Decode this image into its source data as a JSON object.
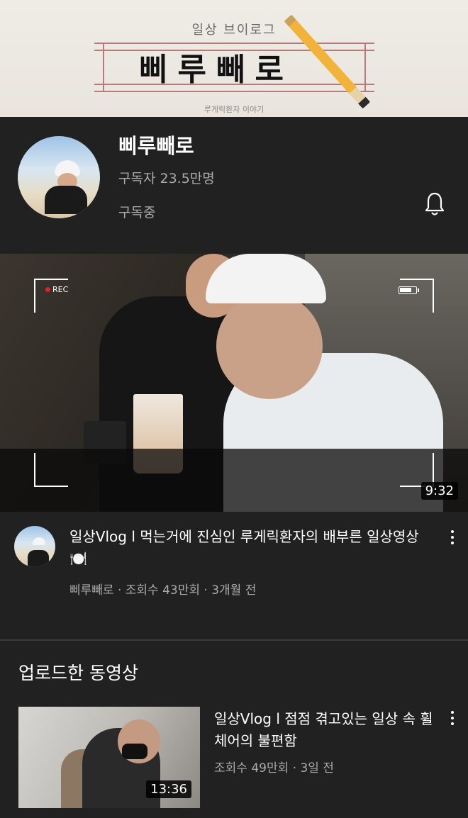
{
  "banner": {
    "subtitle": "일상 브이로그",
    "title": "삐루빼로",
    "caption": "루게릭환자 이야기"
  },
  "channel": {
    "name": "삐루빼로",
    "subscribers": "구독자 23.5만명",
    "subscribed_label": "구독중",
    "notification_icon": "bell-icon"
  },
  "featured": {
    "rec_label": "REC",
    "duration": "9:32",
    "title": "일상Vlog l 먹는거에 진심인 루게릭환자의 배부른 일상영상🍽️",
    "meta": "삐루빼로 · 조회수 43만회 · 3개월 전"
  },
  "uploads": {
    "section_title": "업로드한 동영상",
    "items": [
      {
        "title": "일상Vlog l 점점 겪고있는 일상 속 휠체어의 불편함",
        "meta": "조회수 49만회 · 3일 전",
        "duration": "13:36"
      }
    ]
  },
  "colors": {
    "background": "#212121",
    "text_primary": "#ffffff",
    "text_secondary": "#aaaaaa",
    "rec_dot": "#e52020"
  }
}
